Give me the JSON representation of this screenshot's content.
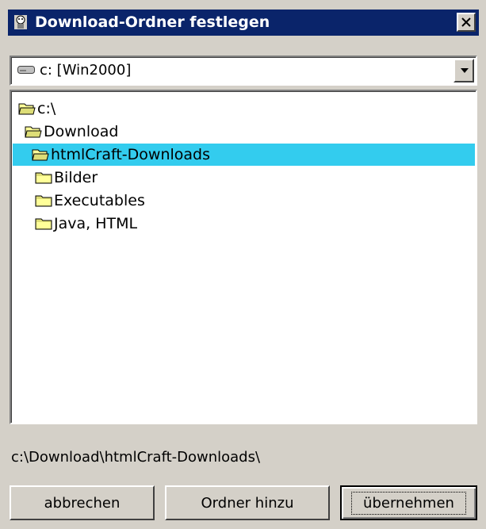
{
  "window": {
    "title": "Download-Ordner festlegen",
    "close_symbol": "×"
  },
  "drive_select": {
    "value": "c: [Win2000]",
    "icon": "drive-icon"
  },
  "tree": {
    "items": [
      {
        "label": "c:\\",
        "icon": "open-folder-icon",
        "selected": false
      },
      {
        "label": "Download",
        "icon": "open-folder-icon",
        "selected": false
      },
      {
        "label": "htmlCraft-Downloads",
        "icon": "open-folder-icon",
        "selected": true
      },
      {
        "label": "Bilder",
        "icon": "folder-icon",
        "selected": false
      },
      {
        "label": "Executables",
        "icon": "folder-icon",
        "selected": false
      },
      {
        "label": "Java, HTML",
        "icon": "folder-icon",
        "selected": false
      }
    ],
    "selection_color": "#33ccee"
  },
  "status": {
    "path": "c:\\Download\\htmlCraft-Downloads\\"
  },
  "buttons": {
    "cancel_label": "abbrechen",
    "add_folder_label": "Ordner hinzu",
    "apply_label": "übernehmen"
  },
  "colors": {
    "title_bar": "#0a246a",
    "dialog_bg": "#d4d0c8"
  }
}
